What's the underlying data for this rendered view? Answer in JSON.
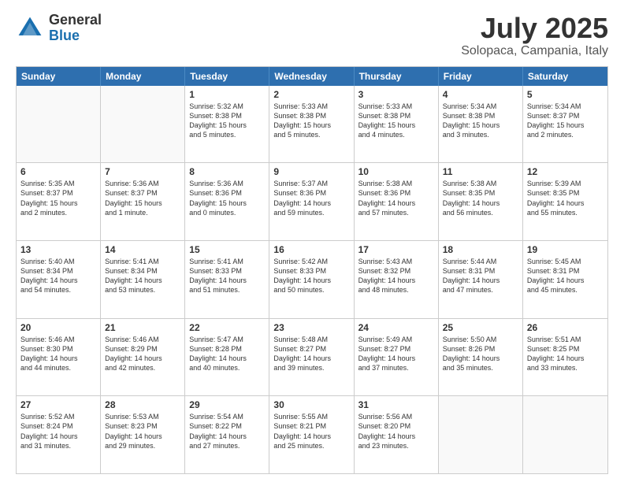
{
  "header": {
    "logo_general": "General",
    "logo_blue": "Blue",
    "month_title": "July 2025",
    "subtitle": "Solopaca, Campania, Italy"
  },
  "calendar": {
    "days_of_week": [
      "Sunday",
      "Monday",
      "Tuesday",
      "Wednesday",
      "Thursday",
      "Friday",
      "Saturday"
    ],
    "weeks": [
      [
        {
          "day": "",
          "empty": true
        },
        {
          "day": "",
          "empty": true
        },
        {
          "day": "1",
          "line1": "Sunrise: 5:32 AM",
          "line2": "Sunset: 8:38 PM",
          "line3": "Daylight: 15 hours",
          "line4": "and 5 minutes."
        },
        {
          "day": "2",
          "line1": "Sunrise: 5:33 AM",
          "line2": "Sunset: 8:38 PM",
          "line3": "Daylight: 15 hours",
          "line4": "and 5 minutes."
        },
        {
          "day": "3",
          "line1": "Sunrise: 5:33 AM",
          "line2": "Sunset: 8:38 PM",
          "line3": "Daylight: 15 hours",
          "line4": "and 4 minutes."
        },
        {
          "day": "4",
          "line1": "Sunrise: 5:34 AM",
          "line2": "Sunset: 8:38 PM",
          "line3": "Daylight: 15 hours",
          "line4": "and 3 minutes."
        },
        {
          "day": "5",
          "line1": "Sunrise: 5:34 AM",
          "line2": "Sunset: 8:37 PM",
          "line3": "Daylight: 15 hours",
          "line4": "and 2 minutes."
        }
      ],
      [
        {
          "day": "6",
          "line1": "Sunrise: 5:35 AM",
          "line2": "Sunset: 8:37 PM",
          "line3": "Daylight: 15 hours",
          "line4": "and 2 minutes."
        },
        {
          "day": "7",
          "line1": "Sunrise: 5:36 AM",
          "line2": "Sunset: 8:37 PM",
          "line3": "Daylight: 15 hours",
          "line4": "and 1 minute."
        },
        {
          "day": "8",
          "line1": "Sunrise: 5:36 AM",
          "line2": "Sunset: 8:36 PM",
          "line3": "Daylight: 15 hours",
          "line4": "and 0 minutes."
        },
        {
          "day": "9",
          "line1": "Sunrise: 5:37 AM",
          "line2": "Sunset: 8:36 PM",
          "line3": "Daylight: 14 hours",
          "line4": "and 59 minutes."
        },
        {
          "day": "10",
          "line1": "Sunrise: 5:38 AM",
          "line2": "Sunset: 8:36 PM",
          "line3": "Daylight: 14 hours",
          "line4": "and 57 minutes."
        },
        {
          "day": "11",
          "line1": "Sunrise: 5:38 AM",
          "line2": "Sunset: 8:35 PM",
          "line3": "Daylight: 14 hours",
          "line4": "and 56 minutes."
        },
        {
          "day": "12",
          "line1": "Sunrise: 5:39 AM",
          "line2": "Sunset: 8:35 PM",
          "line3": "Daylight: 14 hours",
          "line4": "and 55 minutes."
        }
      ],
      [
        {
          "day": "13",
          "line1": "Sunrise: 5:40 AM",
          "line2": "Sunset: 8:34 PM",
          "line3": "Daylight: 14 hours",
          "line4": "and 54 minutes."
        },
        {
          "day": "14",
          "line1": "Sunrise: 5:41 AM",
          "line2": "Sunset: 8:34 PM",
          "line3": "Daylight: 14 hours",
          "line4": "and 53 minutes."
        },
        {
          "day": "15",
          "line1": "Sunrise: 5:41 AM",
          "line2": "Sunset: 8:33 PM",
          "line3": "Daylight: 14 hours",
          "line4": "and 51 minutes."
        },
        {
          "day": "16",
          "line1": "Sunrise: 5:42 AM",
          "line2": "Sunset: 8:33 PM",
          "line3": "Daylight: 14 hours",
          "line4": "and 50 minutes."
        },
        {
          "day": "17",
          "line1": "Sunrise: 5:43 AM",
          "line2": "Sunset: 8:32 PM",
          "line3": "Daylight: 14 hours",
          "line4": "and 48 minutes."
        },
        {
          "day": "18",
          "line1": "Sunrise: 5:44 AM",
          "line2": "Sunset: 8:31 PM",
          "line3": "Daylight: 14 hours",
          "line4": "and 47 minutes."
        },
        {
          "day": "19",
          "line1": "Sunrise: 5:45 AM",
          "line2": "Sunset: 8:31 PM",
          "line3": "Daylight: 14 hours",
          "line4": "and 45 minutes."
        }
      ],
      [
        {
          "day": "20",
          "line1": "Sunrise: 5:46 AM",
          "line2": "Sunset: 8:30 PM",
          "line3": "Daylight: 14 hours",
          "line4": "and 44 minutes."
        },
        {
          "day": "21",
          "line1": "Sunrise: 5:46 AM",
          "line2": "Sunset: 8:29 PM",
          "line3": "Daylight: 14 hours",
          "line4": "and 42 minutes."
        },
        {
          "day": "22",
          "line1": "Sunrise: 5:47 AM",
          "line2": "Sunset: 8:28 PM",
          "line3": "Daylight: 14 hours",
          "line4": "and 40 minutes."
        },
        {
          "day": "23",
          "line1": "Sunrise: 5:48 AM",
          "line2": "Sunset: 8:27 PM",
          "line3": "Daylight: 14 hours",
          "line4": "and 39 minutes."
        },
        {
          "day": "24",
          "line1": "Sunrise: 5:49 AM",
          "line2": "Sunset: 8:27 PM",
          "line3": "Daylight: 14 hours",
          "line4": "and 37 minutes."
        },
        {
          "day": "25",
          "line1": "Sunrise: 5:50 AM",
          "line2": "Sunset: 8:26 PM",
          "line3": "Daylight: 14 hours",
          "line4": "and 35 minutes."
        },
        {
          "day": "26",
          "line1": "Sunrise: 5:51 AM",
          "line2": "Sunset: 8:25 PM",
          "line3": "Daylight: 14 hours",
          "line4": "and 33 minutes."
        }
      ],
      [
        {
          "day": "27",
          "line1": "Sunrise: 5:52 AM",
          "line2": "Sunset: 8:24 PM",
          "line3": "Daylight: 14 hours",
          "line4": "and 31 minutes."
        },
        {
          "day": "28",
          "line1": "Sunrise: 5:53 AM",
          "line2": "Sunset: 8:23 PM",
          "line3": "Daylight: 14 hours",
          "line4": "and 29 minutes."
        },
        {
          "day": "29",
          "line1": "Sunrise: 5:54 AM",
          "line2": "Sunset: 8:22 PM",
          "line3": "Daylight: 14 hours",
          "line4": "and 27 minutes."
        },
        {
          "day": "30",
          "line1": "Sunrise: 5:55 AM",
          "line2": "Sunset: 8:21 PM",
          "line3": "Daylight: 14 hours",
          "line4": "and 25 minutes."
        },
        {
          "day": "31",
          "line1": "Sunrise: 5:56 AM",
          "line2": "Sunset: 8:20 PM",
          "line3": "Daylight: 14 hours",
          "line4": "and 23 minutes."
        },
        {
          "day": "",
          "empty": true
        },
        {
          "day": "",
          "empty": true
        }
      ]
    ]
  }
}
